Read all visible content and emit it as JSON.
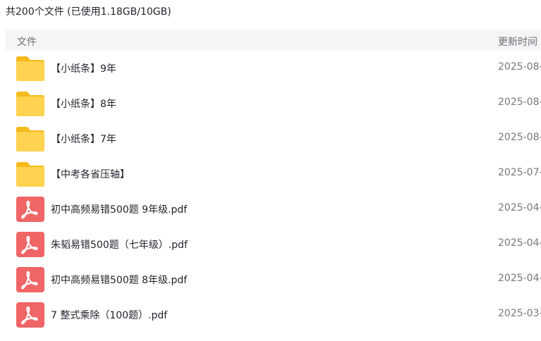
{
  "summary": "共200个文件 (已使用1.18GB/10GB)",
  "table": {
    "headers": {
      "name": "文件",
      "time": "更新时间"
    },
    "rows": [
      {
        "type": "folder",
        "icon": "folder-icon",
        "name": "【小纸条】9年",
        "time": "2025-08-"
      },
      {
        "type": "folder",
        "icon": "folder-icon",
        "name": "【小纸条】8年",
        "time": "2025-08-"
      },
      {
        "type": "folder",
        "icon": "folder-icon",
        "name": "【小纸条】7年",
        "time": "2025-08-"
      },
      {
        "type": "folder",
        "icon": "folder-icon",
        "name": "【中考各省压轴】",
        "time": "2025-07-"
      },
      {
        "type": "pdf",
        "icon": "pdf-icon",
        "name": "初中高频易错500题 9年级.pdf",
        "time": "2025-04-"
      },
      {
        "type": "pdf",
        "icon": "pdf-icon",
        "name": "朱韬易错500题（七年级）.pdf",
        "time": "2025-04-"
      },
      {
        "type": "pdf",
        "icon": "pdf-icon",
        "name": "初中高频易错500题 8年级.pdf",
        "time": "2025-04-"
      },
      {
        "type": "pdf",
        "icon": "pdf-icon",
        "name": "7 整式乘除（100题）.pdf",
        "time": "2025-03-"
      }
    ]
  },
  "colors": {
    "folder": "#ffd34f",
    "folder_tab": "#f5b91a",
    "pdf": "#f06565",
    "header_bg": "#f5f5f6"
  }
}
